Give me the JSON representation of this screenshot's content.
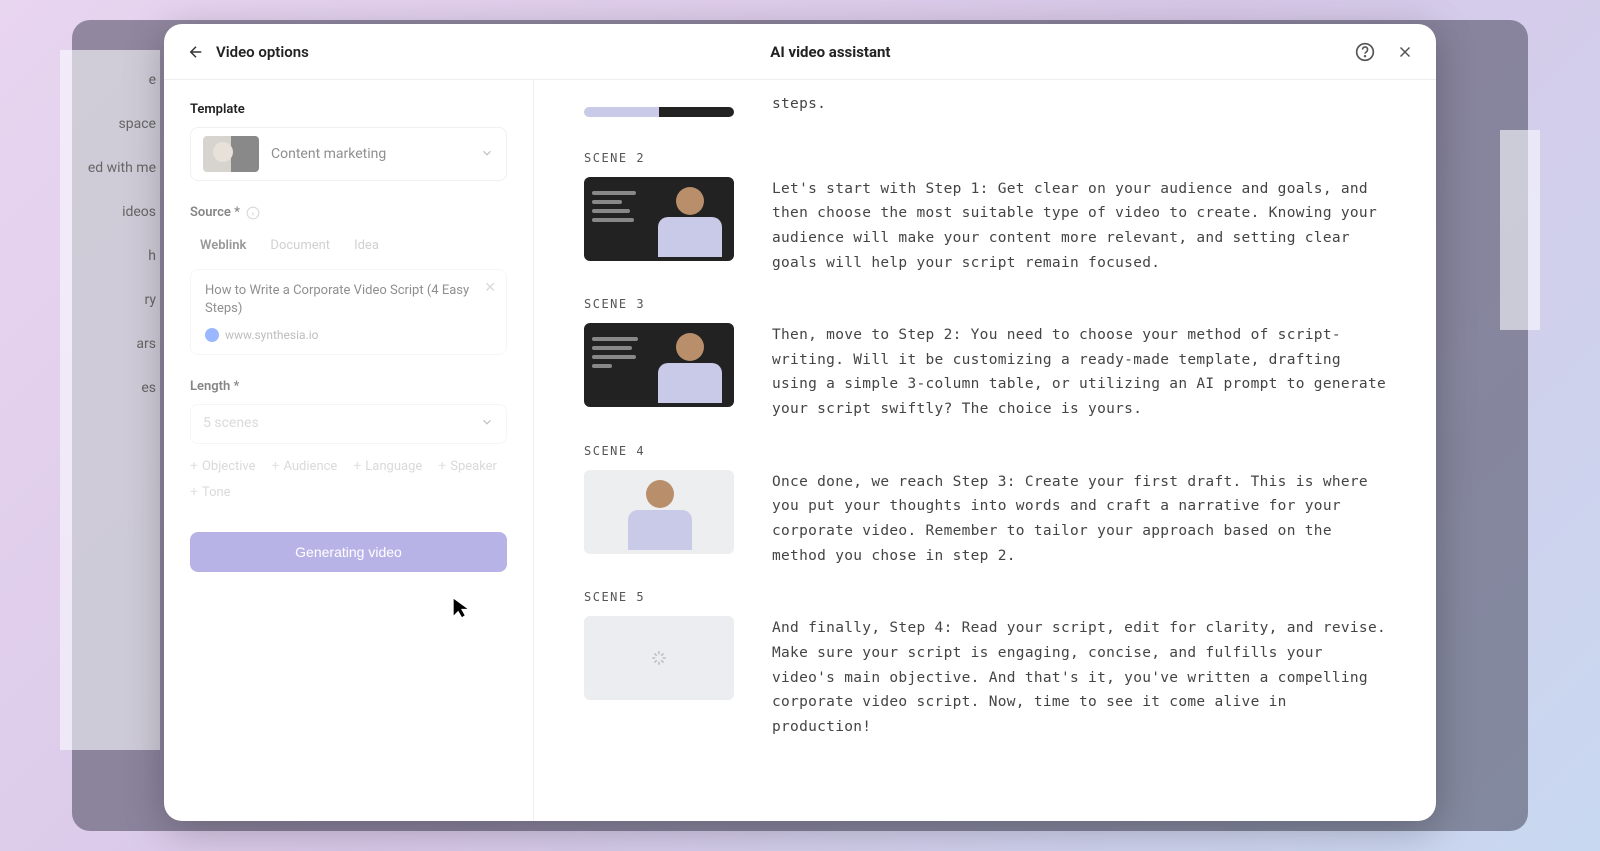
{
  "nav_fragments": [
    "e",
    "space",
    "ed with me",
    "ideos",
    "h",
    "ry",
    "ars",
    "es"
  ],
  "header": {
    "left_title": "Video options",
    "center_title": "AI video assistant"
  },
  "left": {
    "template_label": "Template",
    "template_name": "Content marketing",
    "source_label": "Source *",
    "source_tabs": [
      "Weblink",
      "Document",
      "Idea"
    ],
    "source_active_tab": 0,
    "source_title": "How to Write a Corporate Video Script (4 Easy Steps)",
    "source_url": "www.synthesia.io",
    "length_label": "Length *",
    "length_value": "5 scenes",
    "chips": [
      "Objective",
      "Audience",
      "Language",
      "Speaker",
      "Tone"
    ],
    "generate_button": "Generating video"
  },
  "scenes": [
    {
      "label": "",
      "text": "steps.",
      "thumb_style": "partial"
    },
    {
      "label": "SCENE 2",
      "text": "Let's start with Step 1: Get clear on your audience and goals, and then choose the most suitable type of video to create. Knowing your audience will make your content more relevant, and setting clear goals will help your script remain focused.",
      "thumb_style": "dark-bullets"
    },
    {
      "label": "SCENE 3",
      "text": "Then, move to Step 2: You need to choose your method of script-writing. Will it be customizing a ready-made template, drafting using a simple 3-column table, or utilizing an AI prompt to generate your script swiftly? The choice is yours.",
      "thumb_style": "dark-bullets"
    },
    {
      "label": "SCENE 4",
      "text": "Once done, we reach Step 3: Create your first draft. This is where you put your thoughts into words and craft a narrative for your corporate video. Remember to tailor your approach based on the method you chose in step 2.",
      "thumb_style": "light"
    },
    {
      "label": "SCENE 5",
      "text": "And finally, Step 4: Read your script, edit for clarity, and revise. Make sure your script is engaging, concise, and fulfills your video's main objective. And that's it, you've written a compelling corporate video script. Now, time to see it come alive in production!",
      "thumb_style": "empty"
    }
  ]
}
